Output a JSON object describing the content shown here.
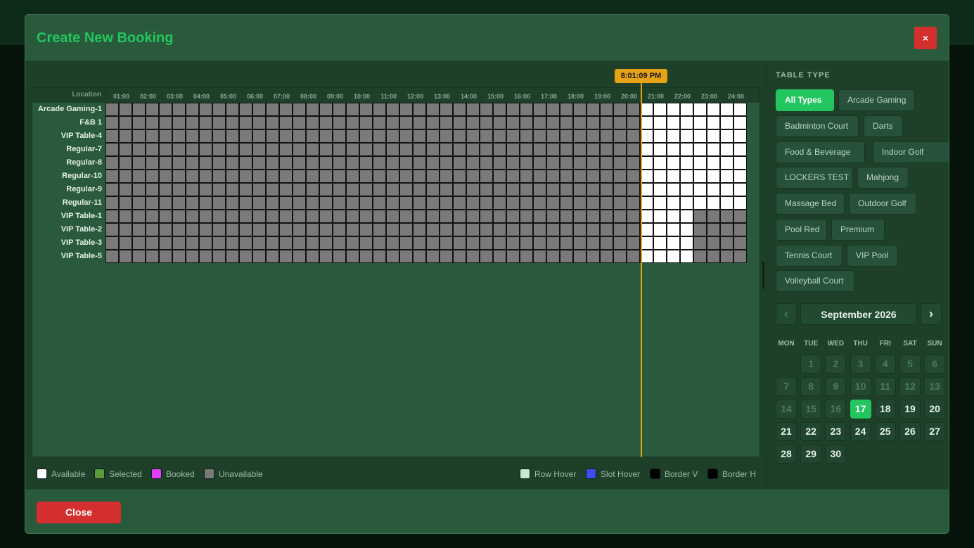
{
  "modal": {
    "title": "Create New Booking",
    "close_x": "×",
    "footer_close": "Close"
  },
  "grid": {
    "location_header": "Location",
    "hours": [
      "01:00",
      "02:00",
      "03:00",
      "04:00",
      "05:00",
      "06:00",
      "07:00",
      "08:00",
      "09:00",
      "10:00",
      "11:00",
      "12:00",
      "13:00",
      "14:00",
      "15:00",
      "16:00",
      "17:00",
      "18:00",
      "19:00",
      "20:00",
      "21:00",
      "22:00",
      "23:00",
      "24:00"
    ],
    "slots_per_hour": 2,
    "current_time": "8:01:09 PM",
    "rows": [
      {
        "name": "Arcade Gaming-1",
        "available_from_slot": 41,
        "available_to_slot": 48
      },
      {
        "name": "F&B 1",
        "available_from_slot": 41,
        "available_to_slot": 48
      },
      {
        "name": "VIP Table-4",
        "available_from_slot": 41,
        "available_to_slot": 48
      },
      {
        "name": "Regular-7",
        "available_from_slot": 41,
        "available_to_slot": 48
      },
      {
        "name": "Regular-8",
        "available_from_slot": 41,
        "available_to_slot": 48
      },
      {
        "name": "Regular-10",
        "available_from_slot": 41,
        "available_to_slot": 48
      },
      {
        "name": "Regular-9",
        "available_from_slot": 41,
        "available_to_slot": 48
      },
      {
        "name": "Regular-11",
        "available_from_slot": 41,
        "available_to_slot": 48
      },
      {
        "name": "VIP Table-1",
        "available_from_slot": 41,
        "available_to_slot": 44
      },
      {
        "name": "VIP Table-2",
        "available_from_slot": 41,
        "available_to_slot": 44
      },
      {
        "name": "VIP Table-3",
        "available_from_slot": 41,
        "available_to_slot": 44
      },
      {
        "name": "VIP Table-5",
        "available_from_slot": 41,
        "available_to_slot": 44
      }
    ]
  },
  "legend": [
    {
      "label": "Available",
      "color": "#ffffff"
    },
    {
      "label": "Selected",
      "color": "#5a9a3c"
    },
    {
      "label": "Booked",
      "color": "#e040fb"
    },
    {
      "label": "Unavailable",
      "color": "#7a7a7a"
    },
    {
      "label": "Row Hover",
      "color": "#c8e6d0"
    },
    {
      "label": "Slot Hover",
      "color": "#3d4df0"
    },
    {
      "label": "Border V",
      "color": "#000000"
    },
    {
      "label": "Border H",
      "color": "#000000"
    }
  ],
  "table_type": {
    "title": "TABLE TYPE",
    "options": [
      "All Types",
      "Arcade Gaming",
      "Badminton Court",
      "Darts",
      "Food & Beverage",
      "Indoor Golf",
      "LOCKERS TEST",
      "Mahjong",
      "Massage Bed",
      "Outdoor Golf",
      "Pool Red",
      "Premium",
      "Tennis Court",
      "VIP Pool",
      "Volleyball Court"
    ],
    "selected": "All Types"
  },
  "calendar": {
    "prev": "‹",
    "next": "›",
    "month_label": "September 2026",
    "weekdays": [
      "MON",
      "TUE",
      "WED",
      "THU",
      "FRI",
      "SAT",
      "SUN"
    ],
    "days": [
      "1",
      "2",
      "3",
      "4",
      "5",
      "6",
      "7",
      "8",
      "9",
      "10",
      "11",
      "12",
      "13",
      "14",
      "15",
      "16",
      "17",
      "18",
      "19",
      "20",
      "21",
      "22",
      "23",
      "24",
      "25",
      "26",
      "27",
      "28",
      "29",
      "30"
    ],
    "first_weekday_index": 1,
    "selected_day": "17",
    "today_day": 17
  },
  "colors": {
    "accent": "#22c55e",
    "danger": "#d32f2f",
    "now_marker": "#e6a317",
    "unavailable": "#7a7a7a",
    "available": "#ffffff"
  }
}
